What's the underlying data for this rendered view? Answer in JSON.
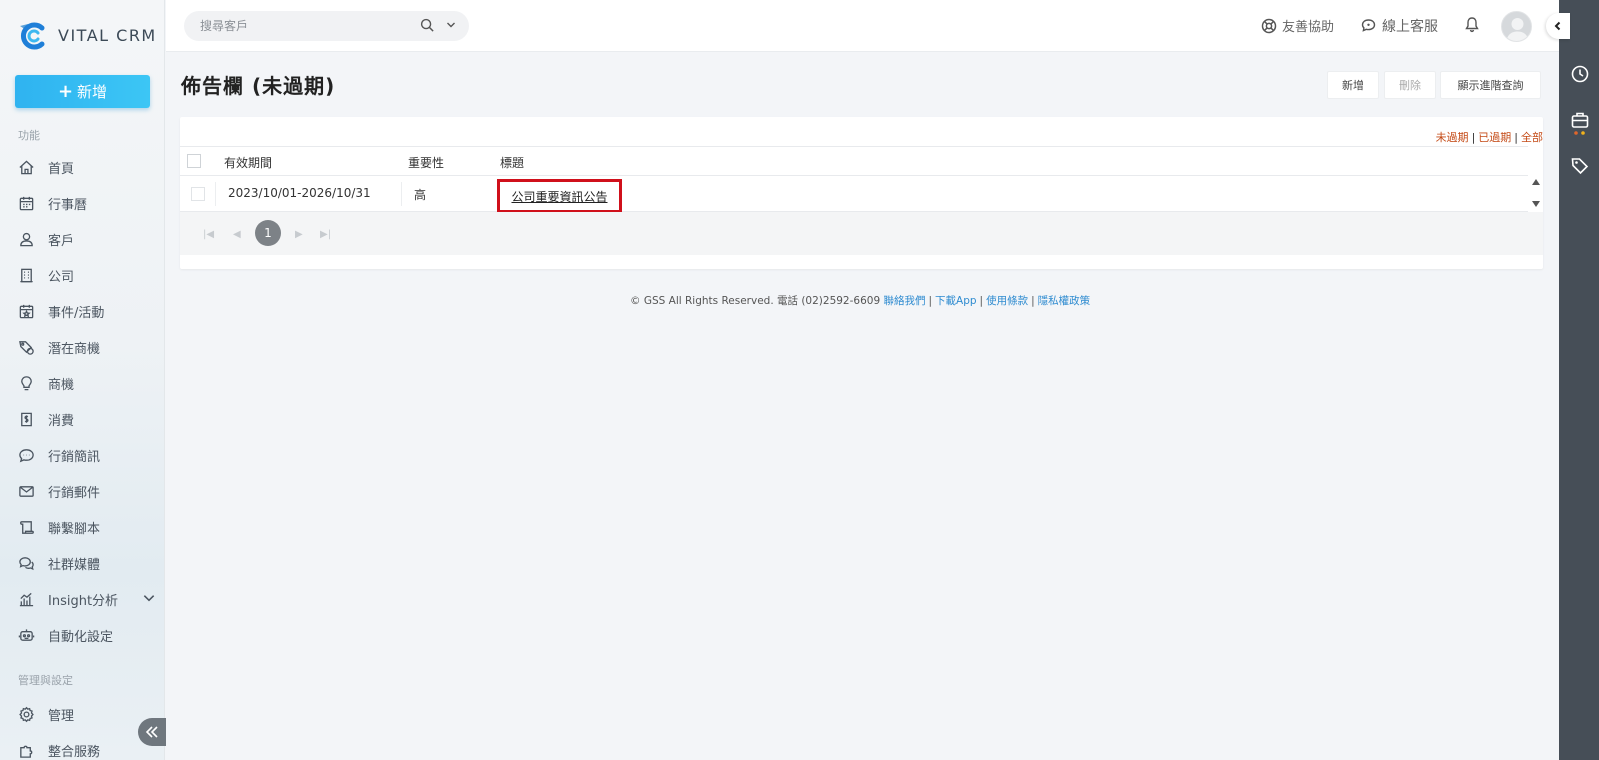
{
  "brand": {
    "name": "VITAL CRM"
  },
  "sidebar": {
    "new_button": "新增",
    "section_function": "功能",
    "section_admin": "管理與設定",
    "items": [
      {
        "label": "首頁",
        "icon": "home-icon"
      },
      {
        "label": "行事曆",
        "icon": "calendar-icon"
      },
      {
        "label": "客戶",
        "icon": "user-icon"
      },
      {
        "label": "公司",
        "icon": "building-icon"
      },
      {
        "label": "事件/活動",
        "icon": "calendar-star-icon"
      },
      {
        "label": "潛在商機",
        "icon": "tag-coin-icon"
      },
      {
        "label": "商機",
        "icon": "lightbulb-icon"
      },
      {
        "label": "消費",
        "icon": "receipt-icon"
      },
      {
        "label": "行銷簡訊",
        "icon": "sms-icon"
      },
      {
        "label": "行銷郵件",
        "icon": "mail-icon"
      },
      {
        "label": "聯繫腳本",
        "icon": "script-icon"
      },
      {
        "label": "社群媒體",
        "icon": "chat-icon"
      },
      {
        "label": "Insight分析",
        "icon": "analytics-icon"
      },
      {
        "label": "自動化設定",
        "icon": "robot-icon"
      }
    ],
    "admin_items": [
      {
        "label": "管理",
        "icon": "gear-icon"
      },
      {
        "label": "整合服務",
        "icon": "puzzle-icon"
      }
    ]
  },
  "topbar": {
    "search_placeholder": "搜尋客戶",
    "help_label": "友善協助",
    "support_label": "線上客服"
  },
  "main": {
    "page_title": "佈告欄 (未過期)",
    "buttons": {
      "add": "新增",
      "delete": "刪除",
      "advanced": "顯示進階查詢"
    },
    "filters": {
      "unexpired": "未過期",
      "expired": "已過期",
      "all": "全部",
      "separator": "|"
    },
    "table": {
      "headers": {
        "period": "有效期間",
        "importance": "重要性",
        "title": "標題"
      },
      "rows": [
        {
          "period": "2023/10/01-2026/10/31",
          "importance": "高",
          "title": "公司重要資訊公告"
        }
      ]
    },
    "pager": {
      "current_page": "1"
    }
  },
  "footer": {
    "copyright": "© GSS All Rights Reserved. 電話 (02)2592-6609",
    "contact": "聯絡我們",
    "download": "下載App",
    "terms": "使用條款",
    "privacy": "隱私權政策",
    "separator": "|"
  },
  "colors": {
    "accent": "#2fb3f0",
    "highlight_border": "#d0101b",
    "filter_link": "#c44a16",
    "rail": "#464e57"
  }
}
